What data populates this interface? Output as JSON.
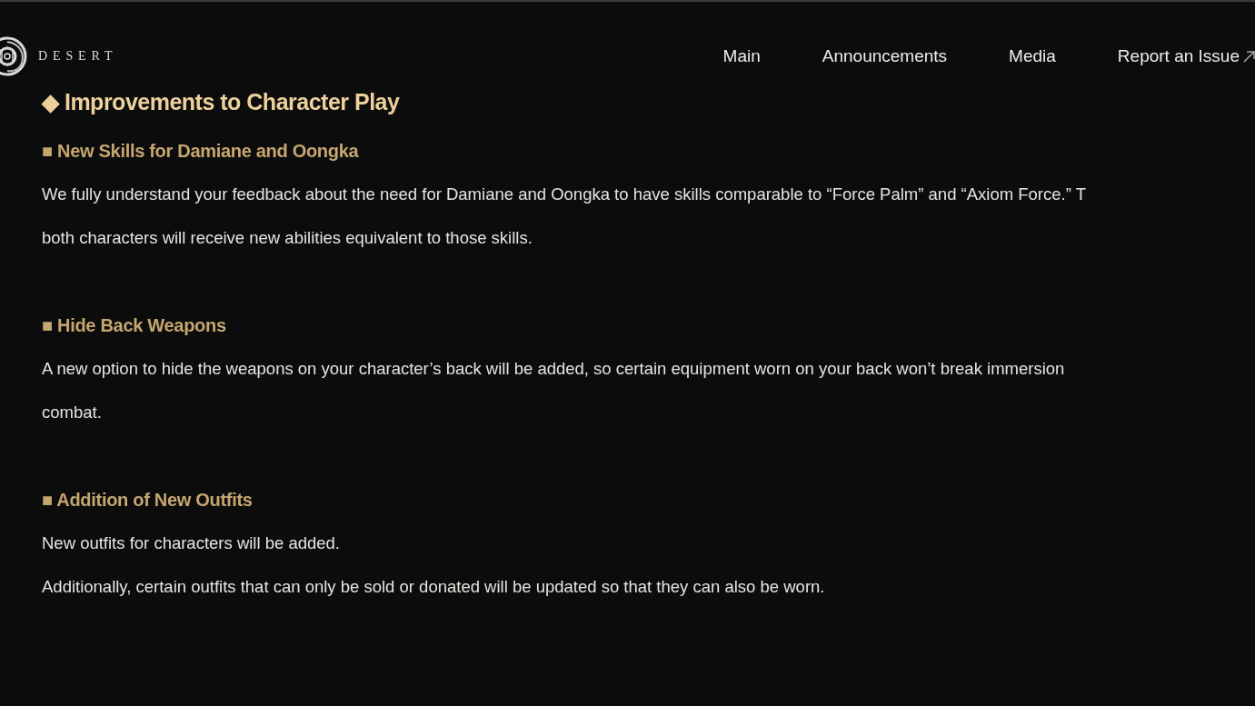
{
  "header": {
    "logo": {
      "wordmark": "DESERT"
    },
    "nav": [
      {
        "label": "Main",
        "kind": "internal"
      },
      {
        "label": "Announcements",
        "kind": "internal"
      },
      {
        "label": "Media",
        "kind": "internal"
      },
      {
        "label": "Report an Issue",
        "kind": "external"
      }
    ]
  },
  "article": {
    "heading": "◆ Improvements to Character Play",
    "sections": [
      {
        "title": "■ New Skills for Damiane and Oongka",
        "lines": [
          "We fully understand your feedback about the need for Damiane and Oongka to have skills comparable to “Force Palm” and “Axiom Force.” T",
          "both characters will receive new abilities equivalent to those skills."
        ]
      },
      {
        "title": "■ Hide Back Weapons",
        "lines": [
          "A new option to hide the weapons on your character’s back will be added, so certain equipment worn on your back won’t break immersion",
          "combat."
        ]
      },
      {
        "title": "■ Addition of New Outfits",
        "lines": [
          "New outfits for characters will be added.",
          "Additionally, certain outfits that can only be sold or donated will be updated so that they can also be worn."
        ]
      }
    ]
  }
}
